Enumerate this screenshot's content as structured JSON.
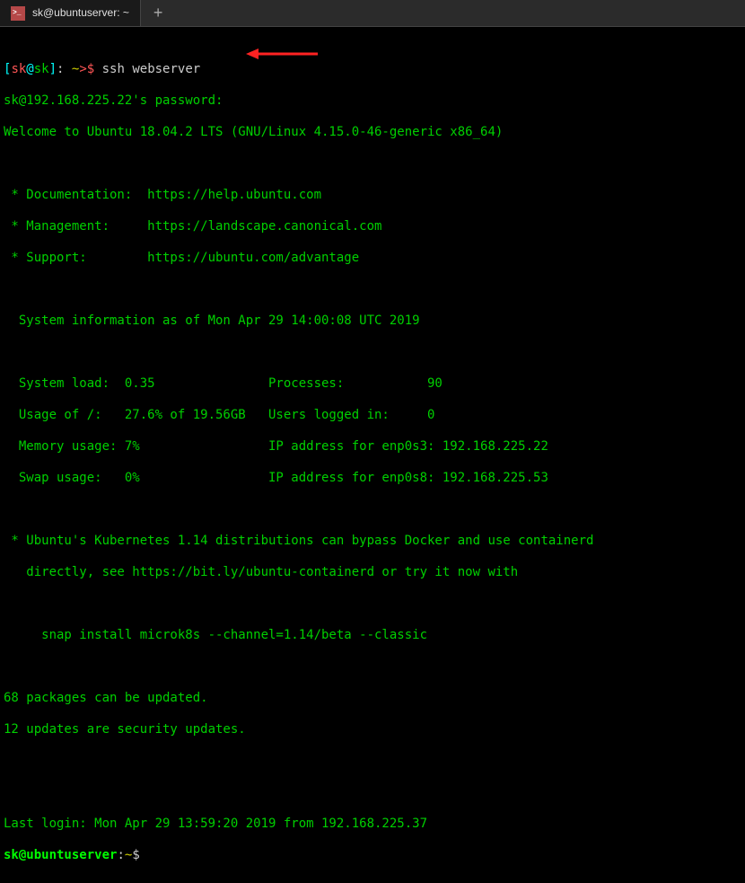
{
  "tabbar": {
    "tab_title": "sk@ubuntuserver: ~",
    "new_tab_symbol": "+"
  },
  "prompt1": {
    "open": "[",
    "user": "sk",
    "at": "@",
    "host": "sk",
    "close": "]",
    "sep": ": ",
    "path": "~",
    "ps": ">$ ",
    "cmd": "ssh webserver"
  },
  "lines": {
    "pw": "sk@192.168.225.22's password:",
    "welcome": "Welcome to Ubuntu 18.04.2 LTS (GNU/Linux 4.15.0-46-generic x86_64)",
    "doc": " * Documentation:  https://help.ubuntu.com",
    "mgmt": " * Management:     https://landscape.canonical.com",
    "sup": " * Support:        https://ubuntu.com/advantage",
    "sysinfo_hdr": "  System information as of Mon Apr 29 14:00:08 UTC 2019",
    "s1": "  System load:  0.35               Processes:           90",
    "s2": "  Usage of /:   27.6% of 19.56GB   Users logged in:     0",
    "s3": "  Memory usage: 7%                 IP address for enp0s3: 192.168.225.22",
    "s4": "  Swap usage:   0%                 IP address for enp0s8: 192.168.225.53",
    "k1": " * Ubuntu's Kubernetes 1.14 distributions can bypass Docker and use containerd",
    "k2": "   directly, see https://bit.ly/ubuntu-containerd or try it now with",
    "snap": "     snap install microk8s --channel=1.14/beta --classic",
    "pkg": "68 packages can be updated.",
    "sec": "12 updates are security updates.",
    "last": "Last login: Mon Apr 29 13:59:20 2019 from 192.168.225.37"
  },
  "prompt2": {
    "user_host": "sk@ubuntuserver",
    "sep": ":",
    "path": "~",
    "ps": "$"
  }
}
